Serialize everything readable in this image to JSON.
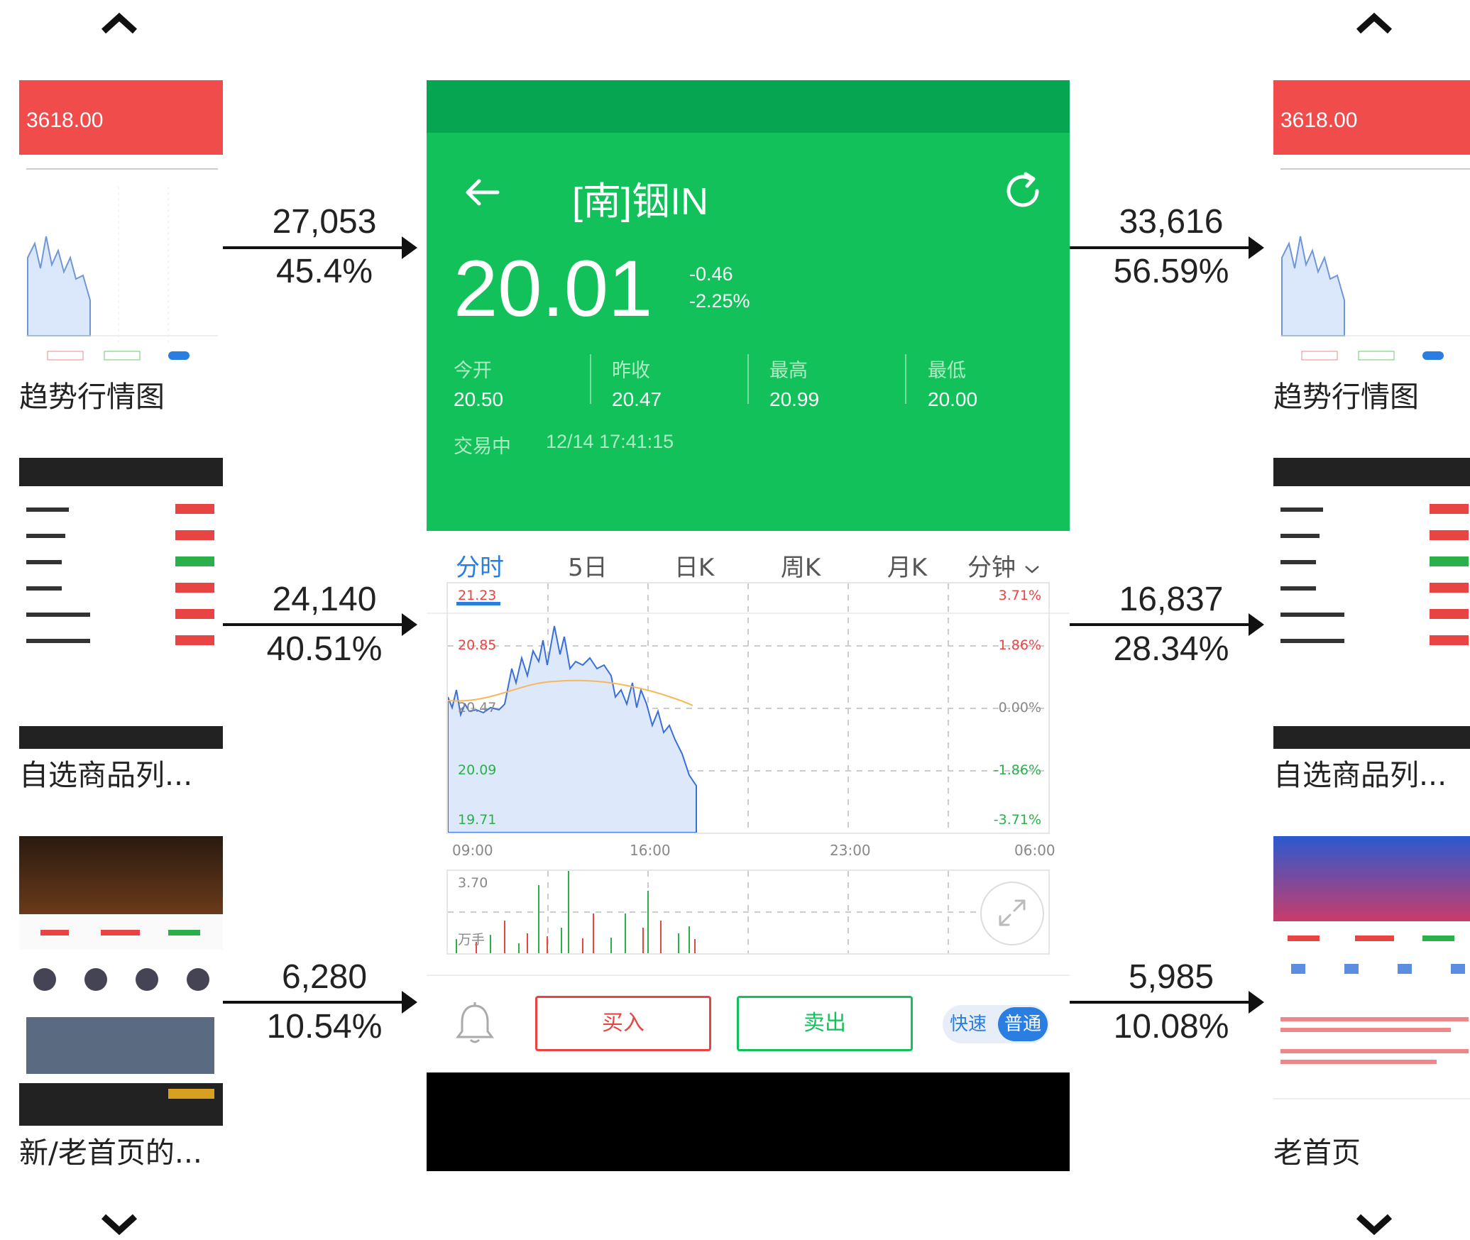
{
  "left_column": {
    "thumbnails": [
      {
        "label": "趋势行情图",
        "price": "3618.00"
      },
      {
        "label": "自选商品列..."
      },
      {
        "label": "新/老首页的..."
      }
    ],
    "flows": [
      {
        "count": "27,053",
        "percent": "45.4%"
      },
      {
        "count": "24,140",
        "percent": "40.51%"
      },
      {
        "count": "6,280",
        "percent": "10.54%"
      }
    ]
  },
  "right_column": {
    "thumbnails": [
      {
        "label": "趋势行情图",
        "price": "3618.00"
      },
      {
        "label": "自选商品列..."
      },
      {
        "label": "老首页"
      }
    ],
    "flows": [
      {
        "count": "33,616",
        "percent": "56.59%"
      },
      {
        "count": "16,837",
        "percent": "28.34%"
      },
      {
        "count": "5,985",
        "percent": "10.08%"
      }
    ]
  },
  "phone": {
    "title": "[南]铟IN",
    "price": "20.01",
    "change": "-0.46",
    "change_pct": "-2.25%",
    "stats": [
      {
        "label": "今开",
        "value": "20.50"
      },
      {
        "label": "昨收",
        "value": "20.47"
      },
      {
        "label": "最高",
        "value": "20.99"
      },
      {
        "label": "最低",
        "value": "20.00"
      }
    ],
    "status": "交易中",
    "datetime": "12/14 17:41:15",
    "tabs": [
      "分时",
      "5日",
      "日K",
      "周K",
      "月K",
      "分钟"
    ],
    "active_tab": "分时",
    "chart": {
      "y_left": [
        "21.23",
        "20.85",
        "20.47",
        "20.09",
        "19.71"
      ],
      "y_right": [
        "3.71%",
        "1.86%",
        "0.00%",
        "-1.86%",
        "-3.71%"
      ],
      "x_labels": [
        "09:00",
        "16:00",
        "23:00",
        "06:00"
      ]
    },
    "volume": {
      "max": "3.70",
      "unit": "万手"
    },
    "buy_label": "买入",
    "sell_label": "卖出",
    "toggle": {
      "fast": "快速",
      "normal": "普通"
    }
  },
  "colors": {
    "green": "#12c15a",
    "red": "#e84444",
    "blue": "#2a7de1"
  }
}
